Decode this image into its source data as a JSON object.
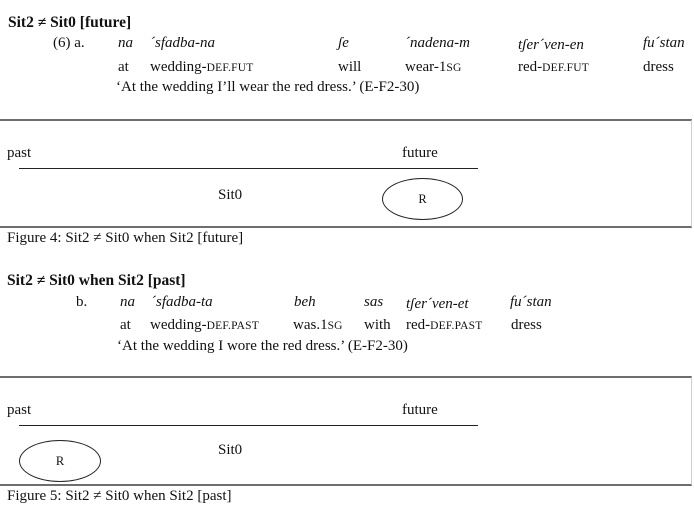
{
  "section_future": {
    "heading": "Sit2 ≠ Sit0 [future]",
    "example_label": "(6) a.",
    "gloss_words": [
      {
        "original": "na",
        "gloss": "at",
        "gloss_small_caps": ""
      },
      {
        "original": "´sfadba-na",
        "gloss": "wedding-",
        "gloss_small_caps": "DEF.FUT"
      },
      {
        "original": "ʃe",
        "gloss": "will",
        "gloss_small_caps": ""
      },
      {
        "original": "´nadena-m",
        "gloss": "wear-1",
        "gloss_small_caps": "SG"
      },
      {
        "original": "tʃer´ven-en",
        "gloss": "red-",
        "gloss_small_caps": "DEF.FUT"
      },
      {
        "original": "fu´stan",
        "gloss": "dress",
        "gloss_small_caps": ""
      }
    ],
    "translation": "‘At the wedding I’ll wear the red dress.’ (E-F2-30)"
  },
  "figure4": {
    "past_label": "past",
    "future_label": "future",
    "sit0_label": "Sit0",
    "r_label": "R",
    "caption": "Figure 4: Sit2 ≠ Sit0 when Sit2 [future]"
  },
  "section_past": {
    "heading": "Sit2 ≠ Sit0 when Sit2 [past]",
    "example_label": "b.",
    "gloss_words": [
      {
        "original": "na",
        "gloss": "at",
        "gloss_small_caps": ""
      },
      {
        "original": "´sfadba-ta",
        "gloss": "wedding-",
        "gloss_small_caps": "DEF.PAST"
      },
      {
        "original": "beh",
        "gloss": "was.1",
        "gloss_small_caps": "SG"
      },
      {
        "original": "sas",
        "gloss": "with",
        "gloss_small_caps": ""
      },
      {
        "original": "tʃer´ven-et",
        "gloss": "red-",
        "gloss_small_caps": "DEF.PAST"
      },
      {
        "original": "fu´stan",
        "gloss": "dress",
        "gloss_small_caps": ""
      }
    ],
    "translation": "‘At the wedding I wore the red dress.’ (E-F2-30)"
  },
  "figure5": {
    "past_label": "past",
    "future_label": "future",
    "sit0_label": "Sit0",
    "r_label": "R",
    "caption": "Figure 5: Sit2 ≠ Sit0 when Sit2 [past]"
  }
}
